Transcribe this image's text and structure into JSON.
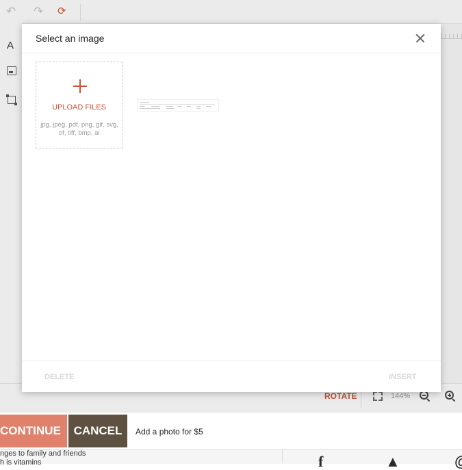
{
  "toolbar": {
    "undo_icon": "undo-icon",
    "redo_icon": "redo-icon",
    "reset_icon": "reset-icon"
  },
  "left_rail": {
    "text_tool": "A"
  },
  "bottom_bar": {
    "rotate_label": "ROTATE",
    "zoom_level": "144%"
  },
  "action_bar": {
    "continue_label": "CONTINUE",
    "cancel_label": "CANCEL",
    "add_photo_text": "Add a photo for $5"
  },
  "footer": {
    "text_line1": "nges to family and friends",
    "text_line2": "h is vitamins",
    "social_icons": [
      "facebook-icon",
      "twitter-icon",
      "pinterest-icon"
    ]
  },
  "modal": {
    "title": "Select an image",
    "upload_label": "UPLOAD FILES",
    "upload_formats": "jpg, jpeg, pdf, png, gif, svg, tif, tiff, bmp, ai",
    "delete_label": "DELETE",
    "insert_label": "INSERT"
  },
  "colors": {
    "accent": "#d2503a",
    "continue_bg": "#e0826b",
    "cancel_bg": "#5e5142",
    "rotate": "#c1563c"
  }
}
